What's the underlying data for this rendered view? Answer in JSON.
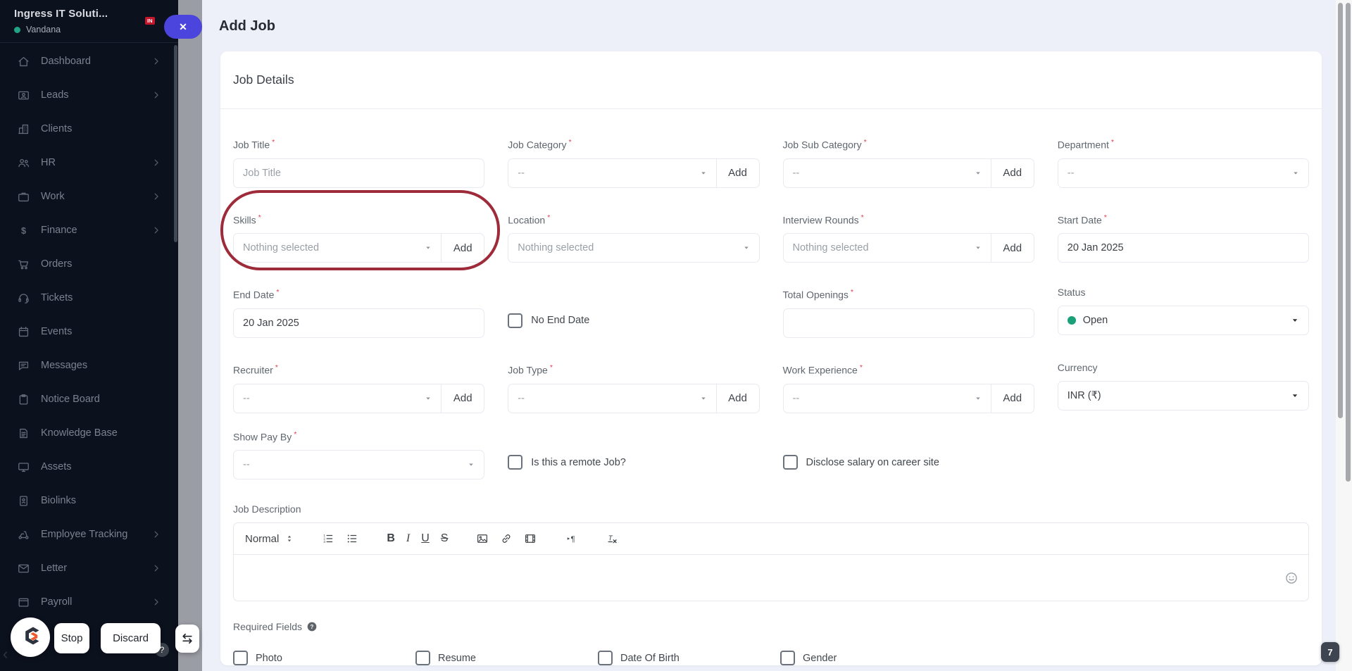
{
  "ui": {
    "required_marker": "*",
    "close_glyph": "✕",
    "add_label": "Add",
    "question_glyph": "?",
    "collapse_arrow": "‹"
  },
  "colors": {
    "sidebar_bg": "#0c111e",
    "modal_bg": "#edf0f8",
    "close_button": "#4b45dd",
    "annotation_stroke": "#9e2b39",
    "status_open_dot": "#1aa179",
    "online_dot": "#23a385",
    "in_badge": "#c3172c"
  },
  "sidebar": {
    "company": "Ingress IT Soluti...",
    "badge": "IN",
    "user": "Vandana",
    "items": [
      {
        "label": "Dashboard",
        "icon": "home",
        "chevron": true
      },
      {
        "label": "Leads",
        "icon": "contact-card",
        "chevron": true
      },
      {
        "label": "Clients",
        "icon": "building",
        "chevron": false
      },
      {
        "label": "HR",
        "icon": "users",
        "chevron": true
      },
      {
        "label": "Work",
        "icon": "briefcase",
        "chevron": true
      },
      {
        "label": "Finance",
        "icon": "dollar",
        "chevron": true
      },
      {
        "label": "Orders",
        "icon": "cart",
        "chevron": false
      },
      {
        "label": "Tickets",
        "icon": "headset",
        "chevron": false
      },
      {
        "label": "Events",
        "icon": "calendar",
        "chevron": false
      },
      {
        "label": "Messages",
        "icon": "chat",
        "chevron": false
      },
      {
        "label": "Notice Board",
        "icon": "clipboard",
        "chevron": false
      },
      {
        "label": "Knowledge Base",
        "icon": "document",
        "chevron": false
      },
      {
        "label": "Assets",
        "icon": "monitor",
        "chevron": false
      },
      {
        "label": "Biolinks",
        "icon": "id-badge",
        "chevron": false
      },
      {
        "label": "Employee Tracking",
        "icon": "scooter",
        "chevron": true
      },
      {
        "label": "Letter",
        "icon": "envelope",
        "chevron": true
      },
      {
        "label": "Payroll",
        "icon": "payroll",
        "chevron": true
      }
    ]
  },
  "modal": {
    "title": "Add Job"
  },
  "card": {
    "title": "Job Details"
  },
  "form": {
    "job_title": {
      "label": "Job Title",
      "placeholder": "Job Title",
      "value": ""
    },
    "job_category": {
      "label": "Job Category",
      "value": "--"
    },
    "job_sub_category": {
      "label": "Job Sub Category",
      "value": "--"
    },
    "department": {
      "label": "Department",
      "value": "--"
    },
    "skills": {
      "label": "Skills",
      "value": "Nothing selected"
    },
    "location": {
      "label": "Location",
      "value": "Nothing selected"
    },
    "interview_rounds": {
      "label": "Interview Rounds",
      "value": "Nothing selected"
    },
    "start_date": {
      "label": "Start Date",
      "value": "20 Jan 2025"
    },
    "end_date": {
      "label": "End Date",
      "value": "20 Jan 2025"
    },
    "no_end_date": {
      "label": "No End Date",
      "checked": false
    },
    "total_openings": {
      "label": "Total Openings",
      "value": ""
    },
    "status": {
      "label": "Status",
      "value": "Open"
    },
    "recruiter": {
      "label": "Recruiter",
      "value": "--"
    },
    "job_type": {
      "label": "Job Type",
      "value": "--"
    },
    "work_experience": {
      "label": "Work Experience",
      "value": "--"
    },
    "currency": {
      "label": "Currency",
      "value": "INR (₹)"
    },
    "show_pay_by": {
      "label": "Show Pay By",
      "value": "--"
    },
    "remote_job": {
      "label": "Is this a remote Job?",
      "checked": false
    },
    "disclose_salary": {
      "label": "Disclose salary on career site",
      "checked": false
    }
  },
  "editor": {
    "label": "Job Description",
    "format": "Normal",
    "bold": "B",
    "italic": "I",
    "underline": "U",
    "strike": "S"
  },
  "required_fields": {
    "label": "Required Fields",
    "options": [
      "Photo",
      "Resume",
      "Date Of Birth",
      "Gender"
    ]
  },
  "recorder": {
    "stop": "Stop",
    "discard": "Discard"
  },
  "page_badge": "7"
}
